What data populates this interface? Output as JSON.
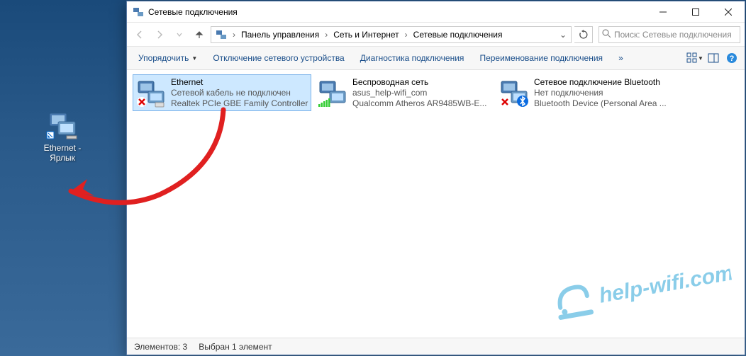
{
  "desktop": {
    "shortcut_label": "Ethernet - Ярлык"
  },
  "window": {
    "title": "Сетевые подключения",
    "titlebar": {
      "minimize": "—",
      "maximize": "☐",
      "close": "✕"
    },
    "breadcrumb": {
      "items": [
        "Панель управления",
        "Сеть и Интернет",
        "Сетевые подключения"
      ]
    },
    "search": {
      "placeholder": "Поиск: Сетевые подключения"
    },
    "commands": {
      "organize": "Упорядочить",
      "disable": "Отключение сетевого устройства",
      "diagnose": "Диагностика подключения",
      "rename": "Переименование подключения",
      "more": "»"
    },
    "connections": [
      {
        "name": "Ethernet",
        "status": "Сетевой кабель не подключен",
        "device": "Realtek PCIe GBE Family Controller",
        "icon": "ethernet-disconnected",
        "selected": true
      },
      {
        "name": "Беспроводная сеть",
        "status": "asus_help-wifi_com",
        "device": "Qualcomm Atheros AR9485WB-E...",
        "icon": "wifi-connected",
        "selected": false
      },
      {
        "name": "Сетевое подключение Bluetooth",
        "status": "Нет подключения",
        "device": "Bluetooth Device (Personal Area ...",
        "icon": "bluetooth-disconnected",
        "selected": false
      }
    ],
    "statusbar": {
      "elements": "Элементов: 3",
      "selected": "Выбран 1 элемент"
    }
  },
  "watermark": {
    "text": "help-wifi.com"
  }
}
